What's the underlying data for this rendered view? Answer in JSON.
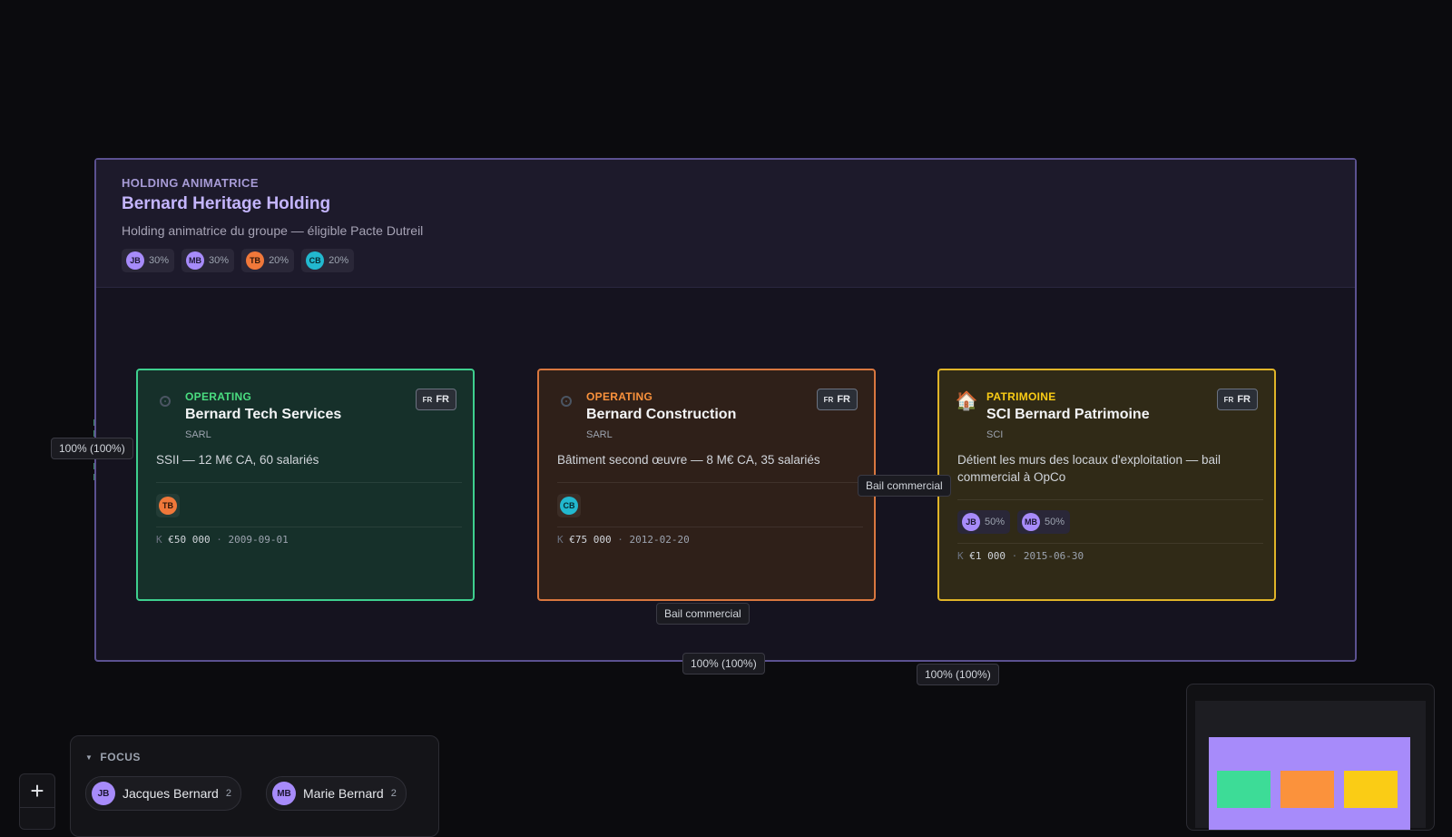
{
  "holding": {
    "kicker": "HOLDING ANIMATRICE",
    "name": "Bernard Heritage Holding",
    "description": "Holding animatrice du groupe — éligible Pacte Dutreil",
    "shareholders": [
      {
        "initials": "JB",
        "pct": "30%"
      },
      {
        "initials": "MB",
        "pct": "30%"
      },
      {
        "initials": "TB",
        "pct": "20%"
      },
      {
        "initials": "CB",
        "pct": "20%"
      }
    ]
  },
  "companies": [
    {
      "kicker": "OPERATING",
      "name": "Bernard Tech Services",
      "type": "SARL",
      "country_flag": "FR",
      "country": "FR",
      "description": "SSII — 12 M€ CA, 60 salariés",
      "owners": [
        {
          "initials": "TB"
        }
      ],
      "capital_prefix": "K",
      "capital": "€50 000",
      "date": "2009-09-01",
      "icon": "target-icon",
      "accent": "#3ecf8e"
    },
    {
      "kicker": "OPERATING",
      "name": "Bernard Construction",
      "type": "SARL",
      "country_flag": "FR",
      "country": "FR",
      "description": "Bâtiment second œuvre — 8 M€ CA, 35 salariés",
      "owners": [
        {
          "initials": "CB"
        }
      ],
      "capital_prefix": "K",
      "capital": "€75 000",
      "date": "2012-02-20",
      "icon": "target-icon",
      "accent": "#d9773f"
    },
    {
      "kicker": "PATRIMOINE",
      "name": "SCI Bernard Patrimoine",
      "type": "SCI",
      "country_flag": "FR",
      "country": "FR",
      "description": "Détient les murs des locaux d'exploitation — bail commercial à OpCo",
      "owners": [
        {
          "initials": "JB",
          "pct": "50%"
        },
        {
          "initials": "MB",
          "pct": "50%"
        }
      ],
      "capital_prefix": "K",
      "capital": "€1 000",
      "date": "2015-06-30",
      "icon": "house-icon",
      "accent": "#e0b428"
    }
  ],
  "edge_labels": {
    "left_ownership": "100% (100%)",
    "bail_right": "Bail commercial",
    "bail_bottom": "Bail commercial",
    "bottom_ownership": "100% (100%)",
    "right_ownership": "100% (100%)"
  },
  "focus": {
    "title": "FOCUS",
    "people": [
      {
        "initials": "JB",
        "name": "Jacques Bernard",
        "count": "2"
      },
      {
        "initials": "MB",
        "name": "Marie Bernard",
        "count": "2"
      }
    ]
  },
  "zoom": {
    "plus": "+"
  },
  "minimap": {
    "holding_color": "#a78bfa",
    "node_colors": [
      "#3ddc97",
      "#fb923c",
      "#facc15"
    ]
  }
}
